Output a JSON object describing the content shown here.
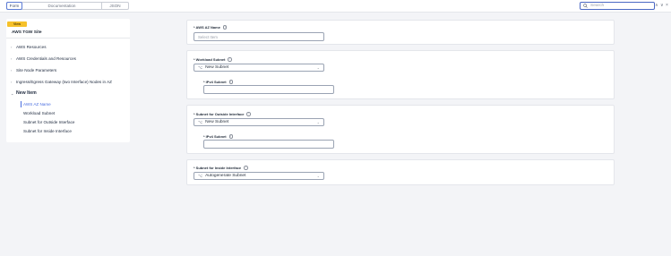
{
  "toolbar": {
    "tabs": [
      "Form",
      "Documentation",
      "JSON"
    ],
    "search_placeholder": "Search",
    "nav_up": "∧",
    "nav_down": "∨",
    "close": "×"
  },
  "left": {
    "badge": "View",
    "title": "AWS TGW Site",
    "items": [
      "AWS Resources",
      "AWS Credentials and Resources",
      "Site Node Parameters",
      "Ingress/Egress Gateway (two Interface) Nodes in AZ",
      "New Item"
    ],
    "sub_items": [
      "AWS AZ Name",
      "Workload Subnet",
      "Subnet for Outside Interface",
      "Subnet for Inside Interface"
    ]
  },
  "form": {
    "az_name": {
      "label": "* AWS AZ Name",
      "placeholder": "Select Item"
    },
    "workload": {
      "label": "* Workload Subnet",
      "value": "New Subnet",
      "ipv4_label": "* IPv4 Subnet"
    },
    "outside": {
      "label": "* Subnet for Outside Interface",
      "value": "New Subnet",
      "ipv4_label": "* IPv4 Subnet"
    },
    "inside": {
      "label": "* Subnet for Inside Interface",
      "value": "Autogenerate Subnet"
    }
  },
  "icons": {
    "info": "i",
    "search": "search-icon",
    "select": "subnet-icon"
  },
  "colors": {
    "accent": "#4a6ee0",
    "badge": "#f6c12a"
  }
}
